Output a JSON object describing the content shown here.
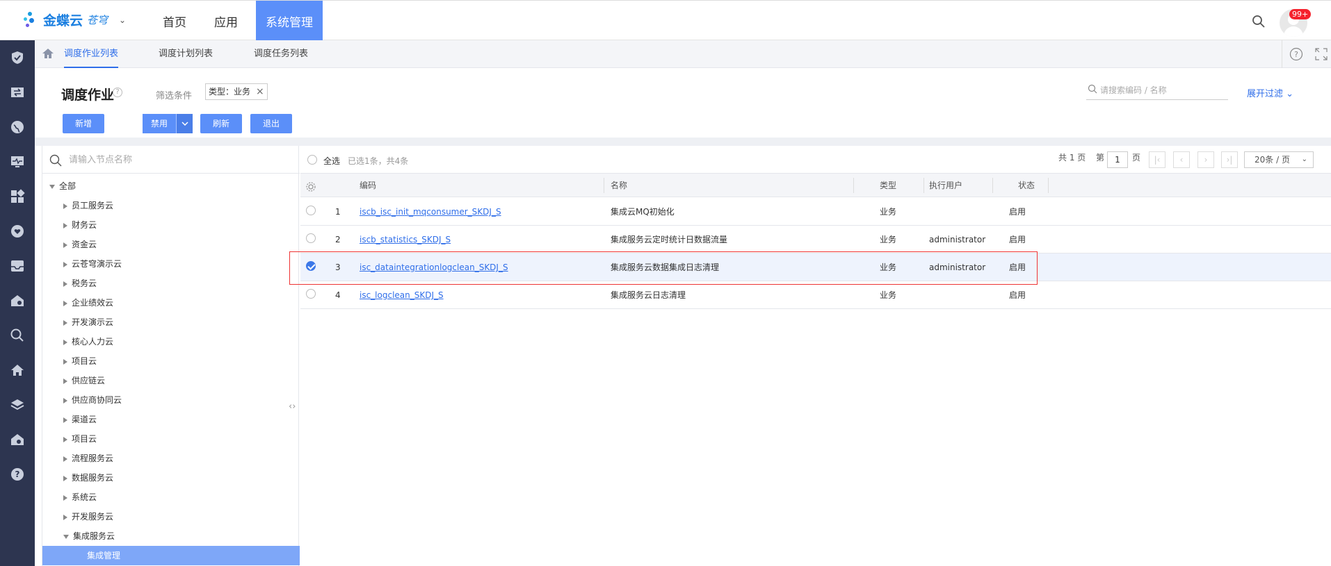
{
  "app": {
    "brand": "金蝶云",
    "brand_sub": "苍穹",
    "nav": [
      {
        "label": "首页"
      },
      {
        "label": "应用"
      },
      {
        "label": "系统管理"
      }
    ],
    "badge": "99+"
  },
  "subtabs": [
    {
      "label": "调度作业列表"
    },
    {
      "label": "调度计划列表"
    },
    {
      "label": "调度任务列表"
    }
  ],
  "header": {
    "title": "调度作业",
    "filter_label": "筛选条件",
    "filter_tag": "类型：业务",
    "search_placeholder": "请搜索编码 / 名称",
    "expand_filter": "展开过滤",
    "buttons": {
      "add": "新增",
      "disable": "禁用",
      "refresh": "刷新",
      "exit": "退出"
    }
  },
  "tree": {
    "search_placeholder": "请输入节点名称",
    "root": "全部",
    "items": [
      "员工服务云",
      "财务云",
      "资金云",
      "云苍穹演示云",
      "税务云",
      "企业绩效云",
      "开发演示云",
      "核心人力云",
      "项目云",
      "供应链云",
      "供应商协同云",
      "渠道云",
      "项目云",
      "流程服务云",
      "数据服务云",
      "系统云",
      "开发服务云",
      "集成服务云"
    ],
    "selected_child": "集成管理"
  },
  "grid": {
    "select_all": "全选",
    "selection_info": "已选1条，共4条",
    "pager": {
      "total_pages": "共 1 页",
      "page_prefix": "第",
      "page": "1",
      "page_suffix": "页",
      "page_size": "20条 / 页"
    },
    "columns": [
      "编码",
      "名称",
      "类型",
      "执行用户",
      "状态"
    ],
    "rows": [
      {
        "no": "1",
        "code": "iscb_isc_init_mqconsumer_SKDJ_S",
        "name": "集成云MQ初始化",
        "type": "业务",
        "user": "",
        "status": "启用",
        "checked": false
      },
      {
        "no": "2",
        "code": "iscb_statistics_SKDJ_S",
        "name": "集成服务云定时统计日数据流量",
        "type": "业务",
        "user": "administrator",
        "status": "启用",
        "checked": false
      },
      {
        "no": "3",
        "code": "isc_dataintegrationlogclean_SKDJ_S",
        "name": "集成服务云数据集成日志清理",
        "type": "业务",
        "user": "administrator",
        "status": "启用",
        "checked": true
      },
      {
        "no": "4",
        "code": "isc_logclean_SKDJ_S",
        "name": "集成服务云日志清理",
        "type": "业务",
        "user": "",
        "status": "启用",
        "checked": false
      }
    ]
  },
  "colors": {
    "primary": "#5b8ff9",
    "rail": "#2d3550",
    "link": "#2f6ee9",
    "highlight": "#e33333"
  }
}
